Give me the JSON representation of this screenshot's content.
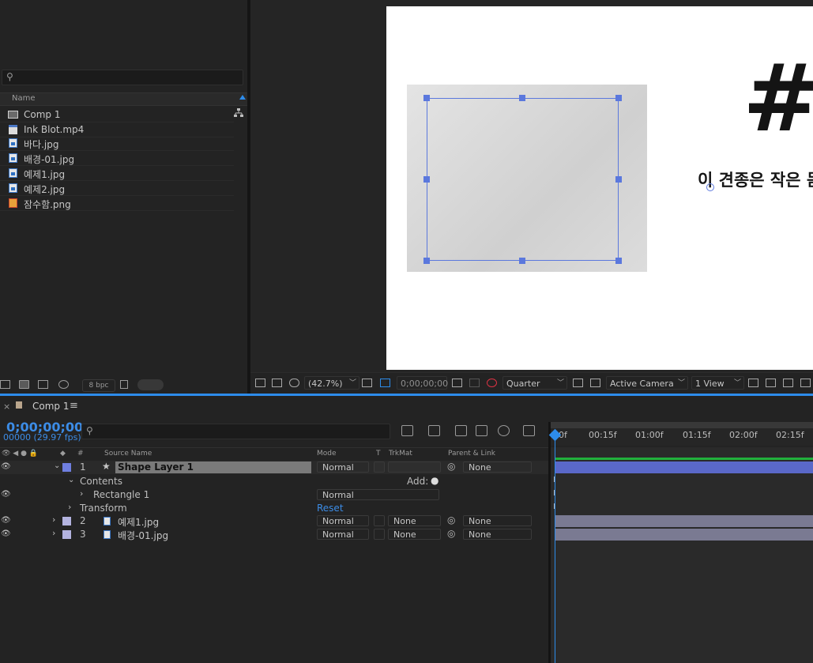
{
  "project": {
    "search_placeholder": "",
    "column_name": "Name",
    "items": [
      {
        "name": "Comp 1",
        "icon": "composition-icon"
      },
      {
        "name": "Ink Blot.mp4",
        "icon": "video-file-icon"
      },
      {
        "name": "바다.jpg",
        "icon": "image-file-icon"
      },
      {
        "name": "배경-01.jpg",
        "icon": "image-file-icon"
      },
      {
        "name": "예제1.jpg",
        "icon": "image-file-icon"
      },
      {
        "name": "예제2.jpg",
        "icon": "image-file-icon"
      },
      {
        "name": "잠수함.png",
        "icon": "png-file-icon"
      }
    ],
    "bpc": "8 bpc"
  },
  "viewer": {
    "canvas_hash": "#",
    "canvas_text": "이 견종은 작은 몸",
    "zoom": "(42.7%)",
    "timecode": "0;00;00;00",
    "resolution": "Quarter",
    "camera": "Active Camera",
    "views": "1 View"
  },
  "timeline": {
    "tab_close": "×",
    "tab_label": "Comp 1",
    "tab_menu": "≡",
    "timecode": "0;00;00;00",
    "frames": "00000 (29.97 fps)",
    "ruler_ticks": [
      "0f",
      "00:15f",
      "01:00f",
      "01:15f",
      "02:00f",
      "02:15f"
    ],
    "columns": {
      "num": "#",
      "source_name": "Source Name",
      "mode": "Mode",
      "t": "T",
      "trkmat": "TrkMat",
      "parent": "Parent & Link"
    },
    "layers": [
      {
        "num": "1",
        "name": "Shape Layer 1",
        "mode": "Normal",
        "trkmat": "",
        "parent": "None",
        "color": "#6f7fe0"
      },
      {
        "num": "2",
        "name": "예제1.jpg",
        "mode": "Normal",
        "trkmat": "None",
        "parent": "None",
        "color": "#b3b3df"
      },
      {
        "num": "3",
        "name": "배경-01.jpg",
        "mode": "Normal",
        "trkmat": "None",
        "parent": "None",
        "color": "#b3b3df"
      }
    ],
    "contents_label": "Contents",
    "add_label": "Add:",
    "rectangle_label": "Rectangle 1",
    "rectangle_mode": "Normal",
    "transform_label": "Transform",
    "reset_label": "Reset"
  },
  "colors": {
    "accent": "#2d8ceb",
    "selection": "#5b78dd"
  }
}
